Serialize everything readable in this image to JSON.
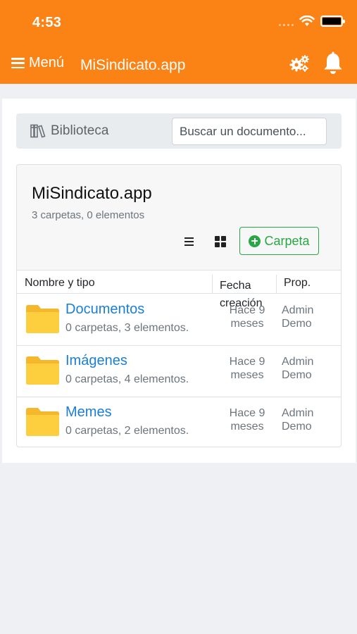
{
  "status_bar": {
    "time": "4:53"
  },
  "header": {
    "menu_label": "Menú",
    "app_title": "MiSindicato.app",
    "icons": [
      "hamburger-icon",
      "gears-icon",
      "bell-icon"
    ]
  },
  "library": {
    "label": "Biblioteca",
    "search_placeholder": "Buscar un documento..."
  },
  "folder": {
    "title": "MiSindicato.app",
    "subtitle": "3 carpetas, 0 elementos",
    "new_folder_label": "Carpeta"
  },
  "table": {
    "columns": [
      "Nombre y tipo",
      "Fecha creación",
      "Prop."
    ],
    "rows": [
      {
        "name": "Documentos",
        "sub": "0 carpetas, 3 elementos.",
        "date": "Hace 9 meses",
        "owner": "Admin Demo"
      },
      {
        "name": "Imágenes",
        "sub": "0 carpetas, 4 elementos.",
        "date": "Hace 9 meses",
        "owner": "Admin Demo"
      },
      {
        "name": "Memes",
        "sub": "0 carpetas, 2 elementos.",
        "date": "Hace 9 meses",
        "owner": "Admin Demo"
      }
    ]
  },
  "colors": {
    "brand_orange": "#fb8316",
    "link_blue": "#1a7fd4",
    "success_green": "#28a745",
    "folder_yellow": "#fdcf3f"
  }
}
